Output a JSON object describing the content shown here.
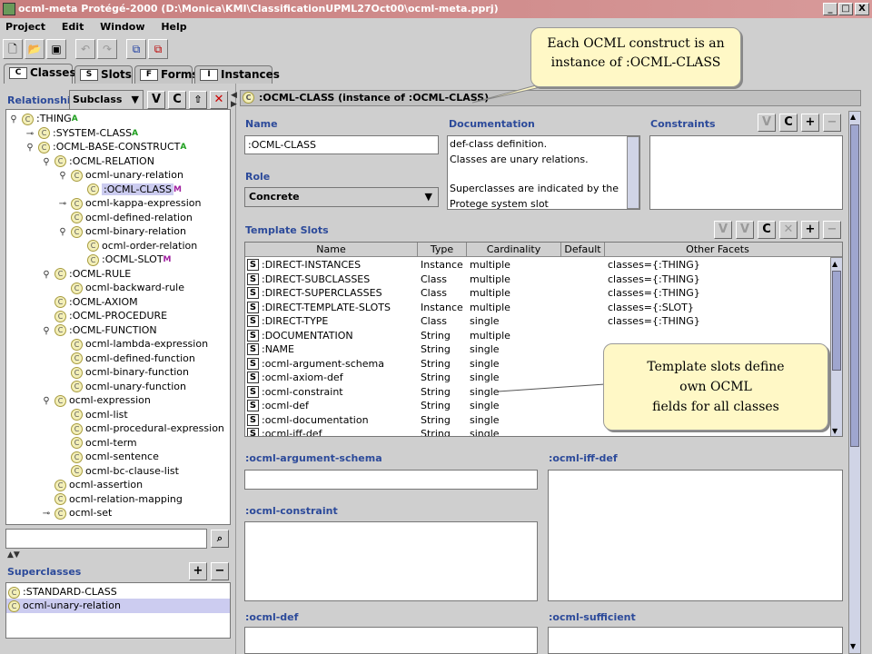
{
  "window": {
    "title": "ocml-meta  Protégé-2000   (D:\\Monica\\KMI\\ClassificationUPML27Oct00\\ocml-meta.pprj)",
    "min": "_",
    "max": "□",
    "close": "X"
  },
  "menu": [
    "Project",
    "Edit",
    "Window",
    "Help"
  ],
  "tabs": [
    {
      "label": "Classes",
      "icon": "C"
    },
    {
      "label": "Slots",
      "icon": "S"
    },
    {
      "label": "Forms",
      "icon": "F"
    },
    {
      "label": "Instances",
      "icon": "I"
    }
  ],
  "relationship": {
    "label": "Relationship",
    "value": "Subclass"
  },
  "tree": [
    {
      "label": ":THING",
      "sup": "A",
      "level": 0,
      "pin": "⚲"
    },
    {
      "label": ":SYSTEM-CLASS",
      "sup": "A",
      "level": 1,
      "pin": "⊸"
    },
    {
      "label": ":OCML-BASE-CONSTRUCT",
      "sup": "A",
      "level": 1,
      "pin": "⚲"
    },
    {
      "label": ":OCML-RELATION",
      "sup": "",
      "level": 2,
      "pin": "⚲"
    },
    {
      "label": "ocml-unary-relation",
      "sup": "",
      "level": 3,
      "pin": "⚲"
    },
    {
      "label": ":OCML-CLASS",
      "sup": "M",
      "level": 4,
      "pin": "",
      "selected": true
    },
    {
      "label": "ocml-kappa-expression",
      "sup": "",
      "level": 3,
      "pin": "⊸"
    },
    {
      "label": "ocml-defined-relation",
      "sup": "",
      "level": 3,
      "pin": ""
    },
    {
      "label": "ocml-binary-relation",
      "sup": "",
      "level": 3,
      "pin": "⚲"
    },
    {
      "label": "ocml-order-relation",
      "sup": "",
      "level": 4,
      "pin": ""
    },
    {
      "label": ":OCML-SLOT",
      "sup": "M",
      "level": 4,
      "pin": ""
    },
    {
      "label": ":OCML-RULE",
      "sup": "",
      "level": 2,
      "pin": "⚲"
    },
    {
      "label": "ocml-backward-rule",
      "sup": "",
      "level": 3,
      "pin": ""
    },
    {
      "label": ":OCML-AXIOM",
      "sup": "",
      "level": 2,
      "pin": ""
    },
    {
      "label": ":OCML-PROCEDURE",
      "sup": "",
      "level": 2,
      "pin": ""
    },
    {
      "label": ":OCML-FUNCTION",
      "sup": "",
      "level": 2,
      "pin": "⚲"
    },
    {
      "label": "ocml-lambda-expression",
      "sup": "",
      "level": 3,
      "pin": ""
    },
    {
      "label": "ocml-defined-function",
      "sup": "",
      "level": 3,
      "pin": ""
    },
    {
      "label": "ocml-binary-function",
      "sup": "",
      "level": 3,
      "pin": ""
    },
    {
      "label": "ocml-unary-function",
      "sup": "",
      "level": 3,
      "pin": ""
    },
    {
      "label": "ocml-expression",
      "sup": "",
      "level": 2,
      "pin": "⚲"
    },
    {
      "label": "ocml-list",
      "sup": "",
      "level": 3,
      "pin": ""
    },
    {
      "label": "ocml-procedural-expression",
      "sup": "",
      "level": 3,
      "pin": ""
    },
    {
      "label": "ocml-term",
      "sup": "",
      "level": 3,
      "pin": ""
    },
    {
      "label": "ocml-sentence",
      "sup": "",
      "level": 3,
      "pin": ""
    },
    {
      "label": "ocml-bc-clause-list",
      "sup": "",
      "level": 3,
      "pin": ""
    },
    {
      "label": "ocml-assertion",
      "sup": "",
      "level": 2,
      "pin": ""
    },
    {
      "label": "ocml-relation-mapping",
      "sup": "",
      "level": 2,
      "pin": ""
    },
    {
      "label": "ocml-set",
      "sup": "",
      "level": 2,
      "pin": "⊸"
    }
  ],
  "superclasses": {
    "label": "Superclasses",
    "items": [
      ":STANDARD-CLASS",
      "ocml-unary-relation"
    ]
  },
  "form": {
    "header": ":OCML-CLASS  (instance of :OCML-CLASS)",
    "name_label": "Name",
    "name_value": ":OCML-CLASS",
    "doc_label": "Documentation",
    "doc_lines": [
      "def-class definition.",
      "Classes are unary relations.",
      "",
      "Superclasses are indicated by the",
      "Protege system slot"
    ],
    "constraints_label": "Constraints",
    "role_label": "Role",
    "role_value": "Concrete",
    "template_label": "Template Slots",
    "columns": [
      "Name",
      "Type",
      "Cardinality",
      "Default",
      "Other Facets"
    ],
    "rows": [
      [
        ":DIRECT-INSTANCES",
        "Instance",
        "multiple",
        "",
        "classes={:THING}"
      ],
      [
        ":DIRECT-SUBCLASSES",
        "Class",
        "multiple",
        "",
        "classes={:THING}"
      ],
      [
        ":DIRECT-SUPERCLASSES",
        "Class",
        "multiple",
        "",
        "classes={:THING}"
      ],
      [
        ":DIRECT-TEMPLATE-SLOTS",
        "Instance",
        "multiple",
        "",
        "classes={:SLOT}"
      ],
      [
        ":DIRECT-TYPE",
        "Class",
        "single",
        "",
        "classes={:THING}"
      ],
      [
        ":DOCUMENTATION",
        "String",
        "multiple",
        "",
        ""
      ],
      [
        ":NAME",
        "String",
        "single",
        "",
        ""
      ],
      [
        ":ocml-argument-schema",
        "String",
        "single",
        "",
        ""
      ],
      [
        ":ocml-axiom-def",
        "String",
        "single",
        "",
        ""
      ],
      [
        ":ocml-constraint",
        "String",
        "single",
        "",
        ""
      ],
      [
        ":ocml-def",
        "String",
        "single",
        "",
        ""
      ],
      [
        ":ocml-documentation",
        "String",
        "single",
        "",
        ""
      ],
      [
        ":ocml-iff-def",
        "String",
        "single",
        "",
        ""
      ]
    ],
    "lower": {
      "arg": ":ocml-argument-schema",
      "iff": ":ocml-iff-def",
      "constraint": ":ocml-constraint",
      "def": ":ocml-def",
      "sufficient": ":ocml-sufficient"
    }
  },
  "callouts": {
    "top": [
      "Each OCML construct is an",
      "instance of :OCML-CLASS"
    ],
    "mid": [
      "Template slots define",
      "own OCML",
      "fields for all classes"
    ]
  }
}
